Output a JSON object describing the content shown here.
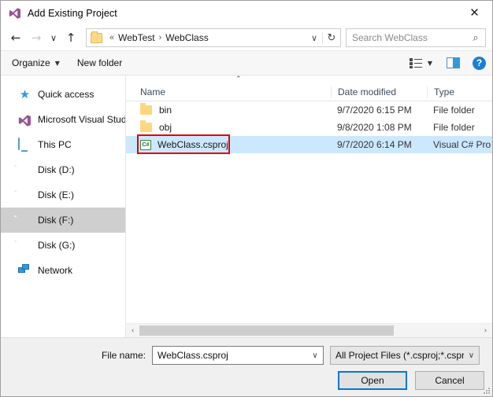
{
  "window": {
    "title": "Add Existing Project",
    "app_icon": "visual-studio-icon",
    "close_label": "✕"
  },
  "nav": {
    "back_icon": "←",
    "forward_icon": "→",
    "recent_icon": "∨",
    "up_icon": "↑",
    "breadcrumb": {
      "folder_icon": "folder-icon",
      "prefix": "«",
      "segments": [
        "WebTest",
        "WebClass"
      ],
      "separator": "›",
      "dropdown_icon": "∨",
      "refresh_icon": "↻"
    },
    "search": {
      "placeholder": "Search WebClass",
      "icon": "⌕"
    }
  },
  "toolbar": {
    "organize_label": "Organize",
    "organize_caret": "▼",
    "new_folder_label": "New folder",
    "view_caret": "▼",
    "view_icon": "view-options-icon",
    "pane_icon": "preview-pane-icon",
    "help_label": "?"
  },
  "sidebar": {
    "items": [
      {
        "label": "Quick access",
        "icon": "star-icon",
        "selected": false
      },
      {
        "label": "Microsoft Visual Stud",
        "icon": "visual-studio-icon",
        "selected": false
      },
      {
        "label": "This PC",
        "icon": "this-pc-icon",
        "selected": false
      },
      {
        "label": "Disk (D:)",
        "icon": "drive-icon",
        "selected": false
      },
      {
        "label": "Disk (E:)",
        "icon": "drive-icon",
        "selected": false
      },
      {
        "label": "Disk (F:)",
        "icon": "drive-icon",
        "selected": true
      },
      {
        "label": "Disk (G:)",
        "icon": "drive-icon",
        "selected": false
      },
      {
        "label": "Network",
        "icon": "network-icon",
        "selected": false
      }
    ]
  },
  "filelist": {
    "sort_caret": "⌃",
    "columns": {
      "name": "Name",
      "date_modified": "Date modified",
      "type": "Type"
    },
    "rows": [
      {
        "name": "bin",
        "icon": "folder-icon",
        "date_modified": "9/7/2020 6:15 PM",
        "type": "File folder",
        "selected": false
      },
      {
        "name": "obj",
        "icon": "folder-icon",
        "date_modified": "9/8/2020 1:08 PM",
        "type": "File folder",
        "selected": false
      },
      {
        "name": "WebClass.csproj",
        "icon": "csharp-project-icon",
        "icon_text": "C#",
        "date_modified": "9/7/2020 6:14 PM",
        "type": "Visual C# Pro",
        "selected": true
      }
    ],
    "annotation_color": "#e50000"
  },
  "scrollbar": {
    "left_arrow": "‹",
    "right_arrow": "›"
  },
  "footer": {
    "file_name_label": "File name:",
    "file_name_value": "WebClass.csproj",
    "file_name_caret": "∨",
    "filter_value": "All Project Files (*.csproj;*.cspro",
    "filter_caret": "∨",
    "open_label": "Open",
    "cancel_label": "Cancel"
  },
  "colors": {
    "accent": "#0078d7",
    "selection": "#cce8ff",
    "annotation": "#e50000"
  }
}
